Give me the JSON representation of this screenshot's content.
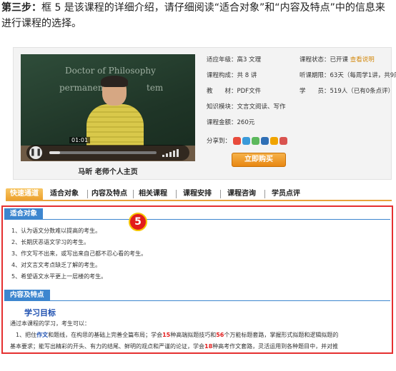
{
  "intro": {
    "step_label": "第三步：",
    "text_part1": "框 5 是该课程的详细介绍，请仔细阅读“适合对象”和“内容及特点”中的信息来",
    "text_part2": "进行课程的选择。"
  },
  "video": {
    "time": "01:01",
    "progress_fraction": 0.1,
    "teacher_link": "马昕 老师个人主页",
    "chalk_lines": [
      "Doctor of Philosophy",
      "permanent",
      "tem"
    ]
  },
  "info": {
    "grade_label": "适应年级：",
    "grade_value": "高3 文理",
    "status_label": "课程状态：",
    "status_value": "已开课",
    "status_link": "查看说明",
    "lessons_label": "课程构成：",
    "lessons_value": "共 8 讲",
    "period_label": "听课期限：",
    "period_value": "63天（每周学1讲，共9周）",
    "material_label": "教　　材：",
    "material_value": "PDF文件",
    "students_label": "学　　员：",
    "students_value": "519人（已有0条点评）",
    "module_label": "知识模块：",
    "module_value": "文言文阅读、写作",
    "price_label": "课程金额：",
    "price_value": "260元",
    "share_label": "分享到：",
    "share_icon_colors": [
      "#e84b3c",
      "#3a9ad9",
      "#5cb85c",
      "#2f6fb5",
      "#f0a400",
      "#d9534f"
    ],
    "buy_label": "立即购买"
  },
  "tabs": {
    "quick": "快速通道",
    "items": [
      "适合对象",
      "内容及特点",
      "相关课程",
      "课程安排",
      "课程咨询",
      "学员点评"
    ]
  },
  "panel": {
    "badge": "5",
    "suitable_title": "适合对象",
    "suitable_items": [
      "1、认为语文分数难以提高的考生。",
      "2、长期厌恶语文学习的考生。",
      "3、作文写不出来，或写出来自己都不忍心看的考生。",
      "4、对文言文考点缺乏了解的考生。",
      "5、希望语文水平更上一层楼的考生。"
    ],
    "content_title": "内容及特点",
    "goal_title": "学习目标",
    "goal_intro": "通过本课程的学习，考生可以：",
    "goal_p1_a": "1、把住",
    "goal_p1_b": "作文",
    "goal_p1_c": "和题线，在构思的基础上完善全篇布局；学会",
    "goal_p1_d": "15",
    "goal_p1_e": "种高端拟题技巧和",
    "goal_p1_f": "56",
    "goal_p1_g": "个万能标题套路，掌握形式拟题和逻辑拟题的",
    "goal_p2_a": "基本要求；能写出精彩的开头、有力的结尾、鲜明的观点和严谨的论证，学会",
    "goal_p2_b": "18",
    "goal_p2_c": "种高考作文套路，灵活运用到各种题目中，并对推"
  },
  "colors": {
    "accent_orange": "#e9a23b",
    "section_blue": "#3d86cf",
    "highlight_red": "#e53030"
  }
}
